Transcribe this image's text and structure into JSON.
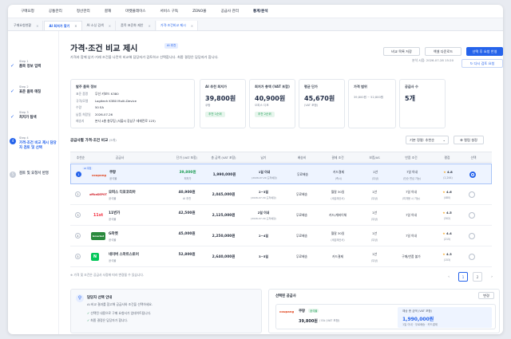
{
  "topnav": [
    "구매요청",
    "공통관리",
    "정산관리",
    "결재",
    "마켓플레이스",
    "서비스 구독",
    "ZENO몰",
    "공급사 관리",
    "통계/분석"
  ],
  "tabs": [
    {
      "label": "구매요청현황",
      "state": ""
    },
    {
      "label": "AI 최저가 찾기",
      "state": "active"
    },
    {
      "label": "AI 소싱 검색",
      "state": ""
    },
    {
      "label": "품목 표준화 제안",
      "state": ""
    },
    {
      "label": "가격·조건비교 제시",
      "state": "current"
    }
  ],
  "steps": [
    {
      "label": "Step 1",
      "name": "품목 정보 입력",
      "state": "done"
    },
    {
      "label": "Step 2",
      "name": "표준 품목 매칭",
      "state": "done"
    },
    {
      "label": "Step 3",
      "name": "최저가 탐색",
      "state": "done"
    },
    {
      "label": "Step 4",
      "name": "가격·조건 비교 제시 담당자 검토 및 선택",
      "state": "current",
      "num": "4"
    },
    {
      "label": "",
      "name": "검토 및 요청서 반영",
      "state": "off",
      "num": "5"
    }
  ],
  "page": {
    "title": "가격·조건 비교 제시",
    "ai_badge": "AI 추천",
    "desc": "가격과 함께 납기·거래 조건을 나란히 비교해 담당자가 검토하고 선택합니다. 최종 결정은 담당자가 합니다.",
    "meta": "분석 시점: 2026-07-28 15:20",
    "buttons": {
      "save": "비교 목록 저장",
      "excel": "엑셀 다운로드",
      "apply": "선택 후 요청 반영",
      "reask": "↻ 다시 검토 요청"
    }
  },
  "item_info": {
    "title": "발주 품목 정보",
    "rows": [
      {
        "k": "표준 품명",
        "v": "무선 키보드 K380"
      },
      {
        "k": "규격/모델",
        "v": "Logitech K380 Multi-Device"
      },
      {
        "k": "수량",
        "v": "50 EA"
      },
      {
        "k": "납품 희망일",
        "v": "2026-07-26"
      },
      {
        "k": "배송지",
        "v": "본사 4층 총무팀 (서울시 강남구 테헤란로 123)"
      }
    ]
  },
  "kpis": [
    {
      "h": "AI 추천 최저가",
      "v": "39,800원",
      "s": "쿠팡",
      "pill": "추천 1순위",
      "pill_bg": "#e6f5ec",
      "pill_fg": "#1f9d55"
    },
    {
      "h": "최저가 총액 (VAT 포함)",
      "v": "40,900원",
      "s": "오피스 디포",
      "pill": "추천 2순위",
      "pill_bg": "#e6f5ec",
      "pill_fg": "#1f9d55"
    },
    {
      "h": "평균 단가",
      "v": "45,670원",
      "s": "(VAT 포함)",
      "pill": "",
      "pill_bg": "",
      "pill_fg": ""
    },
    {
      "h": "가격 범위",
      "v": "",
      "s": "39,800원 ~ 52,800원",
      "pill": "",
      "pill_bg": "",
      "pill_fg": ""
    },
    {
      "h": "공급사 수",
      "v": "5개",
      "s": "",
      "pill": "",
      "pill_bg": "",
      "pill_fg": ""
    }
  ],
  "table": {
    "title": "공급사별 가격·조건 비교",
    "count": "(5개)",
    "sort": "기본 정렬: 추천순",
    "settings": "⚙ 컬럼 설정",
    "headers": [
      "추천순",
      "공급사",
      "단가 (VAT 포함)",
      "총 금액 (VAT 포함)",
      "납기",
      "배송비",
      "결제 조건",
      "보증/AS",
      "반품 조건",
      "평점",
      "선택"
    ],
    "rows": [
      {
        "n": "1",
        "logo": "coupang",
        "tag": "AI 추천",
        "name": "쿠팡",
        "sub": "공식몰",
        "price": "39,800원",
        "psub": "최저가",
        "total": "1,990,000원",
        "lead": "1일 이내",
        "lsub": "(2026-07-29 도착예정)",
        "ship": "무료배송",
        "pay": "카드결제",
        "paysub": "(즉시)",
        "as": "1년",
        "assub": "(무상)",
        "ret": "7일 이내",
        "retsub": "(단순 변심 가능)",
        "rate": "4.8",
        "cnt": "(1,244)",
        "sel": true
      },
      {
        "n": "2",
        "logo": "officeDEPOT",
        "tag": "",
        "name": "오피스 디포코리아",
        "sub": "공식몰",
        "price": "40,900원",
        "psub": "AI 추천",
        "total": "2,045,000원",
        "lead": "2~3일",
        "lsub": "(2026-07-30 도착예정)",
        "ship": "무료배송",
        "pay": "월말 30일",
        "paysub": "(세금계산서)",
        "as": "1년",
        "assub": "(무상)",
        "ret": "7일 이내",
        "retsub": "(미개봉 시 가능)",
        "rate": "4.6",
        "cnt": "(480)",
        "sel": false
      },
      {
        "n": "3",
        "logo": "11st",
        "tag": "",
        "name": "11번가",
        "sub": "공식몰",
        "price": "42,500원",
        "psub": "",
        "total": "2,125,000원",
        "lead": "2일 이내",
        "lsub": "(2026-07-30 도착예정)",
        "ship": "무료배송",
        "pay": "카드/계좌이체",
        "paysub": "",
        "as": "1년",
        "assub": "(무상)",
        "ret": "7일 이내",
        "retsub": "",
        "rate": "4.5",
        "cnt": "(302)",
        "sel": false
      },
      {
        "n": "4",
        "logo": "Gmarket",
        "tag": "",
        "name": "G마켓",
        "sub": "공식몰",
        "price": "45,000원",
        "psub": "",
        "total": "2,250,000원",
        "lead": "2~4일",
        "lsub": "",
        "ship": "무료배송",
        "pay": "월말 30일",
        "paysub": "(세금계산서)",
        "as": "1년",
        "assub": "(무상)",
        "ret": "7일 이내",
        "retsub": "",
        "rate": "4.4",
        "cnt": "(215)",
        "sel": false
      },
      {
        "n": "5",
        "logo": "N",
        "tag": "",
        "name": "네이버 스마트스토어",
        "sub": "공식몰",
        "price": "52,800원",
        "psub": "",
        "total": "2,640,000원",
        "lead": "3~5일",
        "lsub": "",
        "ship": "무료배송",
        "pay": "카드결제",
        "paysub": "",
        "as": "1년",
        "assub": "(무상)",
        "ret": "구매/반품 불가",
        "retsub": "",
        "rate": "4.3",
        "cnt": "(153)",
        "sel": false
      }
    ],
    "note": "※ 가격 및 조건은 공급사 사정에 따라 변경될 수 있습니다.",
    "pages": [
      "‹",
      "1",
      "2",
      "›"
    ]
  },
  "guide": {
    "title": "담당자 선택 안내",
    "desc": "AI 비교 결과를 참고해 공급사와 조건을 선택하세요.",
    "items": [
      "선택된 내용으로 구매 요청서가 업데이트됩니다.",
      "최종 결정은 담당자가 합니다."
    ]
  },
  "selected": {
    "title": "선택된 공급사",
    "change": "변경",
    "logo": "coupang",
    "name": "쿠팡",
    "tag": "공식몰",
    "price": "39,800원",
    "unit": "/ EA (VAT 포함)",
    "total_label": "예상 총 금액 (VAT 포함)",
    "total": "1,990,000원",
    "total_sub": "1일 이내 · 무료배송 · 카드결제"
  }
}
